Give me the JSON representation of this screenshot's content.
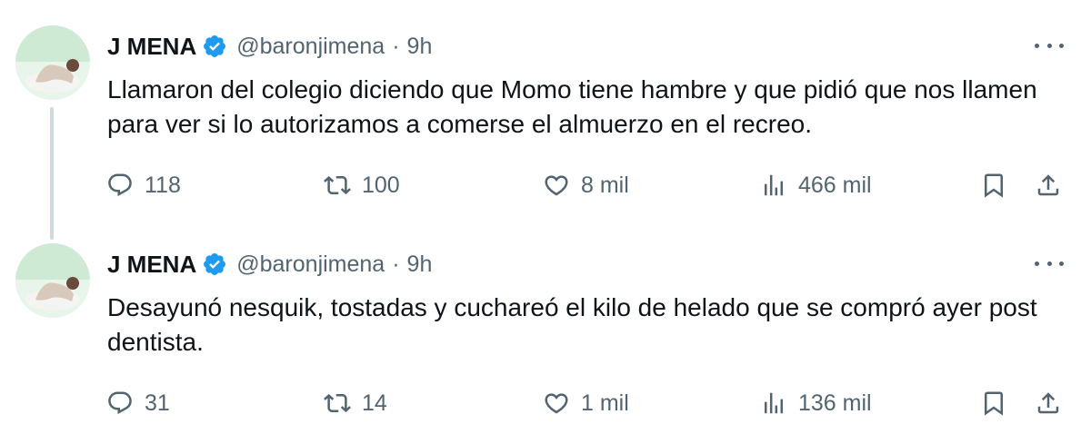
{
  "tweets": [
    {
      "author": {
        "display_name": "J MENA",
        "handle": "@baronjimena",
        "verified": true
      },
      "separator": "·",
      "time": "9h",
      "text": "Llamaron del colegio diciendo que Momo tiene hambre y que pidió que nos llamen para ver si lo autorizamos a comerse el almuerzo en el recreo.",
      "replies": "118",
      "retweets": "100",
      "likes": "8 mil",
      "views": "466 mil"
    },
    {
      "author": {
        "display_name": "J MENA",
        "handle": "@baronjimena",
        "verified": true
      },
      "separator": "·",
      "time": "9h",
      "text": "Desayunó nesquik, tostadas y cuchareó el kilo de helado que se compró ayer post dentista.",
      "replies": "31",
      "retweets": "14",
      "likes": "1 mil",
      "views": "136 mil"
    }
  ],
  "icons": {
    "reply": "reply-icon",
    "retweet": "retweet-icon",
    "like": "heart-icon",
    "views": "views-bar-chart-icon",
    "bookmark": "bookmark-icon",
    "share": "share-icon",
    "more": "more-options-icon",
    "verified": "verified-badge-icon"
  },
  "colors": {
    "text_primary": "#0f1419",
    "text_secondary": "#536471",
    "verified_blue": "#1d9bf0",
    "thread_line": "#cfd9de"
  }
}
